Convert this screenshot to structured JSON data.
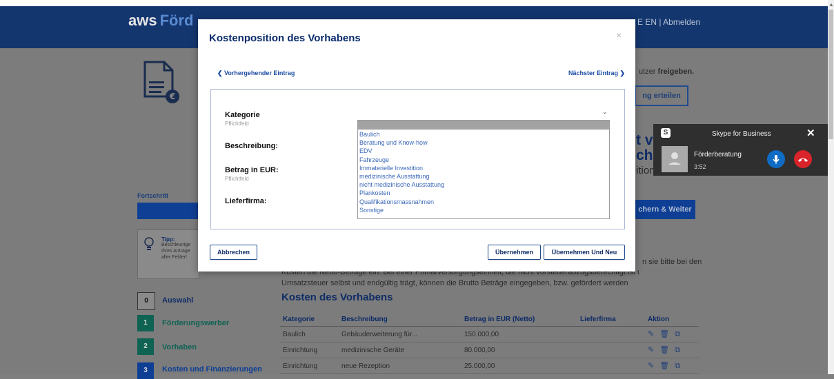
{
  "header": {
    "logo_aws": "aws",
    "logo_suffix": "Förd",
    "lang": "E EN",
    "separator": "|",
    "logout": "Abmelden"
  },
  "background": {
    "release_text": "utzer",
    "release_bold": "freigeben.",
    "grant_button": "ng erteilen",
    "heading_fragment_1": "t vo",
    "heading_fragment_2": "che",
    "heading_fragment_3": "ition",
    "progress_label": "Fortschritt",
    "save_continue": "chern & Weiter",
    "tip_title": "Tipp:",
    "tip_lines": [
      "Beschleunige",
      "Ihres Antrage",
      "aller Felder!"
    ],
    "body_line_1": "Kosten die Netto-Beträge ein. Bei einer Primärversorgungseinheit, die nicht vorsteuerabzugsberechtigt ist und die",
    "body_line_1_end": "n sie bitte bei den",
    "body_line_2": "Umsatzsteuer selbst und endgültig trägt, können die Brutto Beträge eingegeben, bzw. gefördert werden",
    "costs_heading": "Kosten des Vorhabens",
    "steps": [
      {
        "num": "0",
        "label": "Auswahl"
      },
      {
        "num": "1",
        "label": "Förderungswerber"
      },
      {
        "num": "2",
        "label": "Vorhaben"
      },
      {
        "num": "3",
        "label": "Kosten und Finanzierungen"
      }
    ],
    "table": {
      "headers": [
        "Kategorie",
        "Beschreibung",
        "Betrag in EUR (Netto)",
        "Lieferfirma",
        "Aktion"
      ],
      "rows": [
        [
          "Baulich",
          "Gebäuderweiterung für...",
          "150.000,00",
          ""
        ],
        [
          "Einrichtung",
          "medizinische Geräte",
          "80.000,00",
          ""
        ],
        [
          "Einrichtung",
          "neue Rezeption",
          "25.000,00",
          ""
        ]
      ]
    }
  },
  "modal": {
    "title": "Kostenposition des Vorhabens",
    "close": "×",
    "prev_link": "Vorhergehender Eintrag",
    "next_link": "Nächster Eintrag",
    "fields": {
      "kategorie_label": "Kategorie",
      "kategorie_sub": "Pflichtfeld",
      "beschreibung_label": "Beschreibung:",
      "betrag_label": "Betrag in EUR:",
      "betrag_sub": "Pflichtfeld",
      "lieferfirma_label": "Lieferfirma:"
    },
    "dropdown_options": [
      "Baulich",
      "Beratung und Know-how",
      "EDV",
      "Fahrzeuge",
      "Immaterielle Investition",
      "medizinische Ausstattung",
      "nicht medizinische Ausstattung",
      "Plankosten",
      "Qualifikationsmassnahmen",
      "Sonstige"
    ],
    "buttons": {
      "cancel": "Abbrechen",
      "apply": "Übernehmen",
      "apply_new": "Übernehmen Und Neu"
    }
  },
  "skype": {
    "title": "Skype for Business",
    "logo": "S",
    "contact": "Förderberatung",
    "duration": "3:52"
  }
}
